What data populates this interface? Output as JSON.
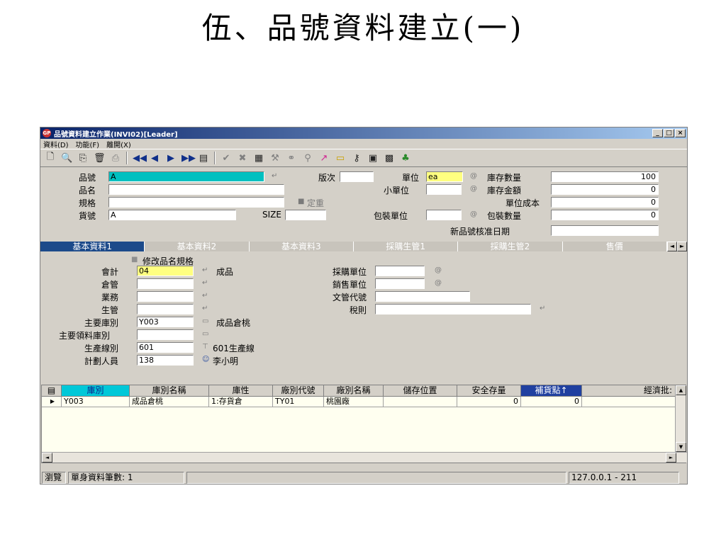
{
  "slide_title": "伍、品號資料建立(一)",
  "window": {
    "app_icon": "GP",
    "title": "品號資料建立作業(INVI02)[Leader]",
    "minimize": "_",
    "maximize": "□",
    "close": "×"
  },
  "menu": [
    "資料(D)",
    "功能(F)",
    "離開(X)"
  ],
  "toolbar_icons": [
    "new-icon",
    "preview-icon",
    "copy-icon",
    "delete-icon",
    "print-icon",
    "first-icon",
    "prev-icon",
    "next-icon",
    "last-icon",
    "query-icon",
    "confirm-icon",
    "cancel-icon",
    "report-icon",
    "tool-icon",
    "link-icon",
    "filter-icon",
    "chart-icon",
    "folder-icon",
    "key-icon",
    "doc-icon",
    "save-icon",
    "user-icon"
  ],
  "header": {
    "item_no_label": "品號",
    "item_no": "A",
    "item_name_label": "品名",
    "item_name": "",
    "spec_label": "規格",
    "spec": "",
    "cargo_no_label": "貨號",
    "cargo_no": "A",
    "size_label": "SIZE",
    "size": "",
    "version_label": "版次",
    "version": "",
    "fixed_price_label": "定重",
    "unit_label": "單位",
    "unit": "ea",
    "small_unit_label": "小單位",
    "small_unit": "",
    "pack_unit_label": "包裝單位",
    "pack_unit": "",
    "stock_qty_label": "庫存數量",
    "stock_qty": "100",
    "stock_amount_label": "庫存金額",
    "stock_amount": "0",
    "unit_cost_label": "單位成本",
    "unit_cost": "0",
    "pack_qty_label": "包裝數量",
    "pack_qty": "0",
    "approve_date_label": "新品號核准日期",
    "approve_date": ""
  },
  "tabs": [
    "基本資料1",
    "基本資料2",
    "基本資料3",
    "採購生管1",
    "採購生管2",
    "售價"
  ],
  "tab_arrows": [
    "◄",
    "►"
  ],
  "basic": {
    "modify_spec_label": "修改品名規格",
    "accounting_label": "會計",
    "accounting": "04",
    "accounting_desc": "成品",
    "warehouse_mgr_label": "倉管",
    "warehouse_mgr": "",
    "sales_label": "業務",
    "sales": "",
    "production_label": "生管",
    "production": "",
    "main_wh_label": "主要庫別",
    "main_wh": "Y003",
    "main_wh_desc": "成品倉桃",
    "main_issue_wh_label": "主要領料庫別",
    "main_issue_wh": "",
    "line_label": "生產線別",
    "line": "601",
    "line_desc": "601生產線",
    "planner_label": "計劃人員",
    "planner": "138",
    "planner_desc": "李小明",
    "purchase_unit_label": "採購單位",
    "purchase_unit": "",
    "sales_unit_label": "銷售單位",
    "sales_unit": "",
    "doc_code_label": "文管代號",
    "doc_code": "",
    "tax_label": "稅則",
    "tax": ""
  },
  "grid": {
    "columns": [
      "庫別",
      "庫別名稱",
      "庫性",
      "廠別代號",
      "廠別名稱",
      "儲存位置",
      "安全存量",
      "補貨點↑",
      "經濟批:"
    ],
    "rows": [
      [
        "Y003",
        "成品倉桃",
        "1:存貨倉",
        "TY01",
        "桃園廠",
        "",
        "0",
        "0",
        ""
      ]
    ]
  },
  "status": {
    "mode": "瀏覽",
    "count": "單身資料筆數: 1",
    "server": "127.0.0.1 - 211"
  }
}
